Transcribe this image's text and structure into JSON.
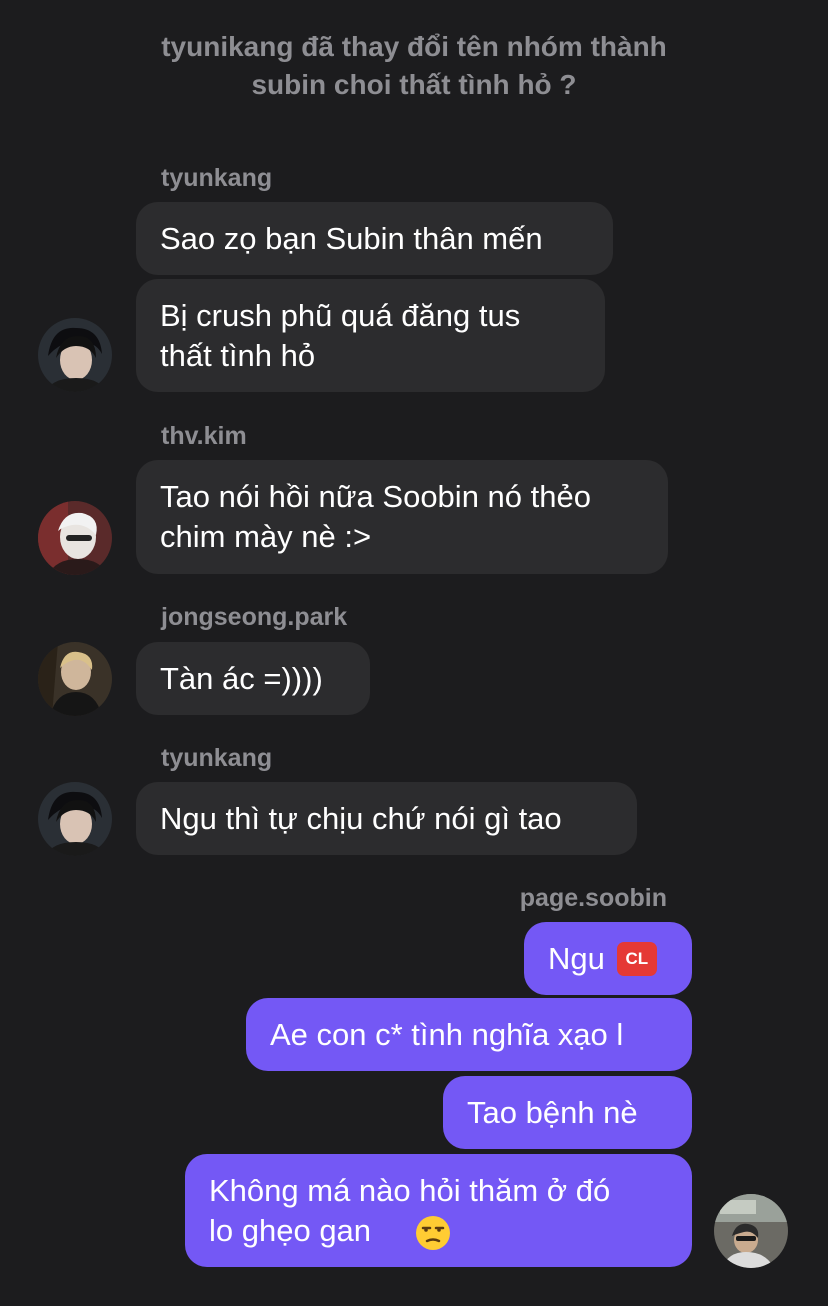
{
  "system_message": "tyunikang đã thay đổi tên nhóm thành\nsubin choi thất tình hỏ ?",
  "senders": {
    "s1": "tyunkang",
    "s2": "thv.kim",
    "s3": "jongseong.park",
    "s4": "tyunkang",
    "s5": "page.soobin"
  },
  "messages": {
    "m1": "Sao zọ bạn Subin thân mến",
    "m2": "Bị crush phũ quá đăng tus\nthất tình hỏ",
    "m3": "Tao nói hồi nữa Soobin nó thẻo\nchim mày nè :>",
    "m4": "Tàn ác =))))",
    "m5": "Ngu thì tự chịu chứ nói gì tao",
    "m6": "Ngu",
    "m6_badge": "CL",
    "m7": "Ae con c* tình nghĩa xạo l",
    "m8": "Tao bệnh nè",
    "m9": "Không má nào hỏi thăm ở đó\nlo ghẹo gan"
  },
  "colors": {
    "background": "#1c1c1e",
    "incoming_bubble": "#2c2c2e",
    "outgoing_bubble": "#7458f5",
    "meta_text": "#8e8e93"
  },
  "icons": {
    "m6_badge_icon": "cl-button-emoji",
    "m9_emoji": "unamused-face-emoji"
  }
}
